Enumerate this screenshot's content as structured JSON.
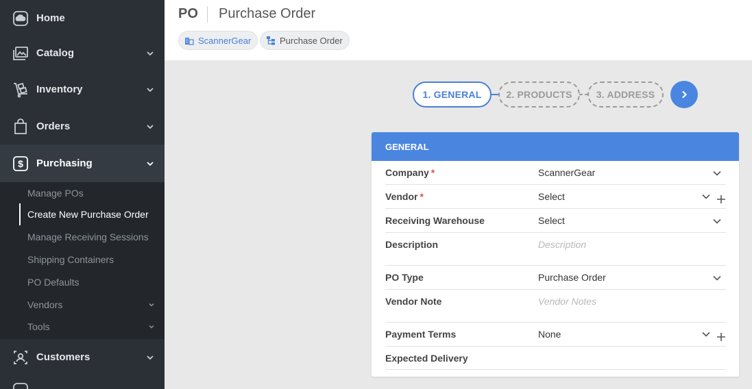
{
  "sidebar": {
    "items": [
      {
        "label": "Home",
        "icon": "home-icon"
      },
      {
        "label": "Catalog",
        "icon": "catalog-icon"
      },
      {
        "label": "Inventory",
        "icon": "inventory-icon"
      },
      {
        "label": "Orders",
        "icon": "orders-icon"
      },
      {
        "label": "Purchasing",
        "icon": "purchasing-icon"
      },
      {
        "label": "Customers",
        "icon": "customers-icon"
      }
    ],
    "purchasing_submenu": [
      {
        "label": "Manage POs"
      },
      {
        "label": "Create New Purchase Order"
      },
      {
        "label": "Manage Receiving Sessions"
      },
      {
        "label": "Shipping Containers"
      },
      {
        "label": "PO Defaults"
      },
      {
        "label": "Vendors"
      },
      {
        "label": "Tools"
      }
    ]
  },
  "header": {
    "short": "PO",
    "title": "Purchase Order",
    "chips": [
      {
        "label": "ScannerGear",
        "icon": "building-icon"
      },
      {
        "label": "Purchase Order",
        "icon": "hierarchy-icon"
      }
    ]
  },
  "stepper": {
    "steps": [
      {
        "label": "1. GENERAL"
      },
      {
        "label": "2. PRODUCTS"
      },
      {
        "label": "3. ADDRESS"
      }
    ]
  },
  "card": {
    "title": "GENERAL",
    "fields": {
      "company": {
        "label": "Company",
        "required": "*",
        "value": "ScannerGear"
      },
      "vendor": {
        "label": "Vendor",
        "required": "*",
        "value": "Select"
      },
      "warehouse": {
        "label": "Receiving Warehouse",
        "value": "Select"
      },
      "description": {
        "label": "Description",
        "placeholder": "Description"
      },
      "po_type": {
        "label": "PO Type",
        "value": "Purchase Order"
      },
      "vendor_note": {
        "label": "Vendor Note",
        "placeholder": "Vendor Notes"
      },
      "payment_terms": {
        "label": "Payment Terms",
        "value": "None"
      },
      "expected_delivery": {
        "label": "Expected Delivery",
        "value": ""
      }
    }
  },
  "colors": {
    "sidebar_bg": "#2b3036",
    "accent": "#4a86e0",
    "required": "#d9534f"
  }
}
